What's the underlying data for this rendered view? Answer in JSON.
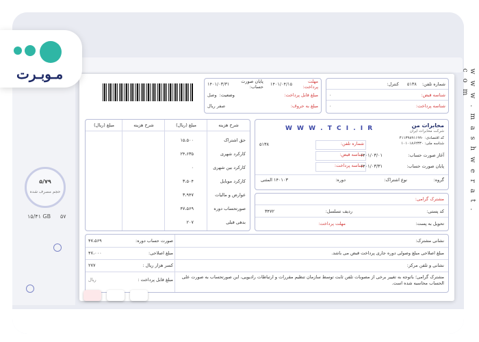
{
  "logo": {
    "text": "مـوبـرت"
  },
  "watermark": "w w w . m a s h w e r a t . c o m",
  "background": {
    "circle_value": "۵/۷۹",
    "circle_caption": "حجم مصرف شده",
    "stat1": "۱۵/۴۱ GB",
    "stat2": "۵۷"
  },
  "invoice": {
    "header_box": {
      "phone_label": "شماره تلفن:",
      "phone_value": "۵۱۳۸",
      "control_label": "کنترل:",
      "bill_id_label": "شناسه قبض:",
      "bill_id_value": "۰",
      "pay_id_label": "شناسه پرداخت:",
      "pay_id_value": "۰"
    },
    "due_box": {
      "due_label": "مهلت پرداخت:",
      "due_value": "۱۴۰۱/۰۴/۱۵",
      "period_end_label": "پایان صورت حساب:",
      "period_end_value": "۱۴۰۱/۰۳/۳۱",
      "payable_label": "مبلغ قابل پرداخت:",
      "status_label": "وضعیت:",
      "status_value": "وصل",
      "words_label": "مبلغ به حروف:",
      "words_value": "صفر ریال"
    },
    "company_box": {
      "company": "مخابرات من",
      "company_sub": "شرکت مخابرات ایران",
      "url": "W W W . T C I . I R",
      "national_id_label": "شناسه ملی:",
      "national_id_value": "۱۰۱۰۱۸۶۲۳۳۰",
      "eco_code_label": "کد اقتصادی:",
      "eco_code_value": "۴۱۱۳۹۸۹۱۱۹۹۰",
      "phone_label": "شماره تلفن:",
      "phone_value": "۵۱۳۸",
      "bill_id_label": "شناسه قبض:",
      "pay_id_label": "شناسه پرداخت:",
      "start_label": "آغاز صورت حساب:",
      "start_value": "۱۴۰۱/۰۳/۰۱",
      "end_label": "پایان صورت حساب:",
      "end_value": "۱۴۰۱/۰۳/۳۱",
      "group_label": "گروه:",
      "sub_type_label": "نوع اشتراک:",
      "period_label": "دوره:",
      "period_value": "۱۴۰۱۰۳ المثنی"
    },
    "customer_box": {
      "title": "مشترک گرامی:",
      "postal_label": "کد پستی:",
      "seq_label": "ردیف تسلسل:",
      "seq_value": "۳۴۷۲",
      "delivery_label": "تحویل به پست:",
      "due_label": "مهلت پرداخت:"
    },
    "charges": {
      "headers": [
        "شرح هزینه",
        "مبلغ (ریال)",
        "شرح هزینه",
        "مبلغ (ریال)"
      ],
      "items": [
        {
          "name": "حق اشتراک",
          "amount": "۱۵،۵۰۰"
        },
        {
          "name": "کارکرد شهری",
          "amount": "۲۴،۶۳۵"
        },
        {
          "name": "کارکرد بین شهری",
          "amount": "۰"
        },
        {
          "name": "کارکرد موبایل",
          "amount": "۳،۵۰۴"
        },
        {
          "name": "عوارض و مالیات",
          "amount": "۳،۹۴۷"
        },
        {
          "name": "صورتحساب دوره",
          "amount": "۴۷،۵۶۹"
        },
        {
          "name": "بدهی قبلی",
          "amount": "۲۰۷"
        }
      ]
    },
    "summary": [
      {
        "label": "صورت حساب دوره:",
        "value": "۴۷،۵۶۹"
      },
      {
        "label": "مبلغ اصلاحی:",
        "value": "۴۷،۰۰۰"
      },
      {
        "label": "کسر هزار ریال :",
        "value": "۲۷۷"
      },
      {
        "label": "مبلغ قابل پرداخت :",
        "value": "ریال"
      }
    ],
    "notes": {
      "address_label": "نشانی مشترک:",
      "note1": "مبلغ اصلاحی مبلغ وصولی دوره جاری پرداخت قبض می باشد.",
      "center_label": "نشانی و تلفن مرکز:",
      "note2": "مشترک گرامی؛ باتوجه به تغییر برخی از مصوبات تلفن ثابت توسط سازمان تنظیم مقررات و ارتباطات رادیویی، این صورتحساب به صورت علی الحساب محاسبه شده است."
    }
  }
}
